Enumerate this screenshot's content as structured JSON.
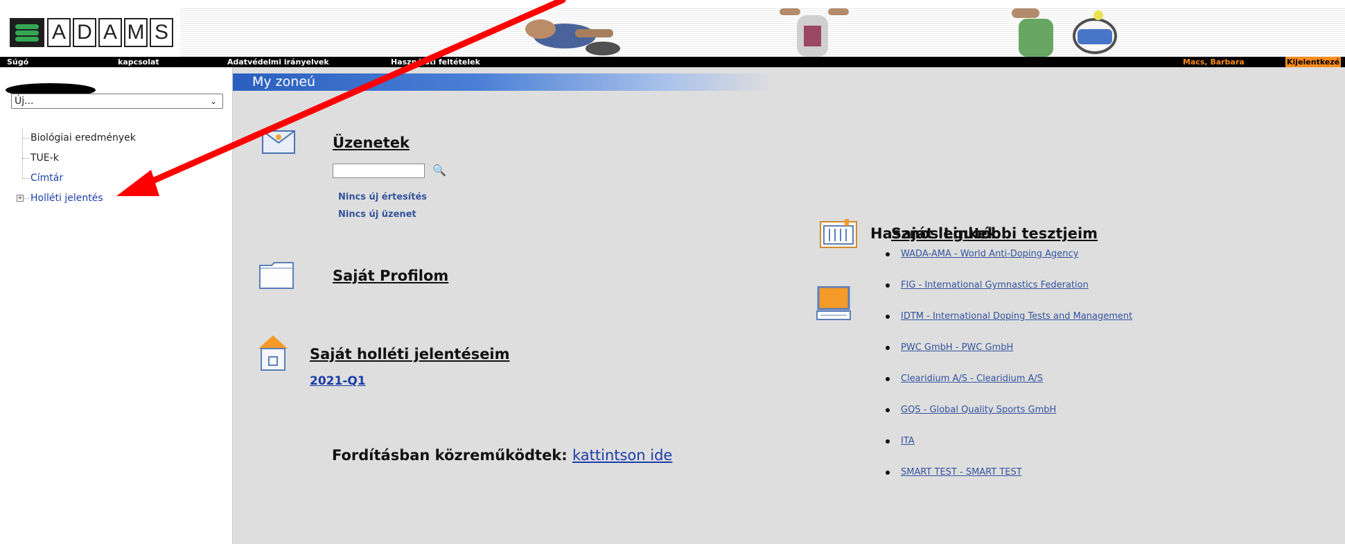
{
  "header": {
    "logo_letters": [
      "A",
      "D",
      "A",
      "M",
      "S"
    ]
  },
  "topbar": {
    "help": "Súgó",
    "contact": "kapcsolat",
    "privacy": "Adatvédelmi irányelvek",
    "terms": "Használati feltételek",
    "user": "Macs,  Barbara",
    "logout": "Kijelentkezé"
  },
  "sidebar": {
    "new_select": {
      "value": "Új..."
    },
    "items": [
      {
        "label": "Biológiai eredmények"
      },
      {
        "label": "TUE-k"
      },
      {
        "label": "Címtár"
      },
      {
        "label": "Holléti jelentés"
      }
    ]
  },
  "main": {
    "zone_title": "My zoneú",
    "messages": {
      "title": "Üzenetek",
      "search_placeholder": "",
      "no_notifications": "Nincs új értesítés",
      "no_messages": "Nincs új üzenet"
    },
    "profile_title": "Saját Profilom",
    "whereabouts": {
      "title": "Saját holléti jelentéseim",
      "period": "2021-Q1"
    },
    "credits": {
      "label": "Fordításban közreműködtek:",
      "link": "kattintson ide"
    },
    "recent_tests_title": "Saját legutóbbi tesztjeim",
    "useful_links": {
      "title": "Hasznos Linkek",
      "items": [
        "WADA-AMA - World Anti-Doping Agency",
        "FIG - International Gymnastics Federation",
        "IDTM - International Doping Tests and Management",
        "PWC GmbH - PWC GmbH",
        "Clearidium A/S - Clearidium A/S",
        "GQS - Global Quality Sports GmbH",
        "ITA",
        "SMART TEST - SMART TEST"
      ]
    }
  },
  "colors": {
    "accent_blue": "#2a5fc0",
    "user_orange": "#ff8c1a",
    "arrow_red": "#ff0000",
    "logo_green": "#34a853"
  },
  "icons": [
    "envelope-icon",
    "folder-icon",
    "house-icon",
    "calendar-folder-icon",
    "computer-icon",
    "search-icon",
    "chevron-down-icon",
    "expand-icon"
  ]
}
